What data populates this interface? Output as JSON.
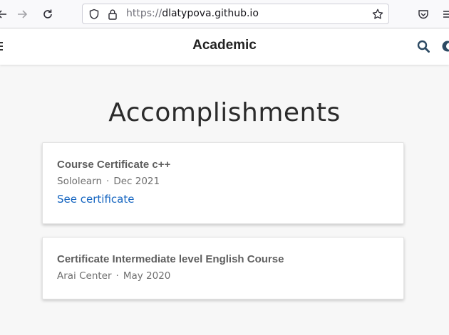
{
  "browser": {
    "url_protocol": "https://",
    "url_host": "dlatypova.github.io",
    "icons": [
      "back-arrow-icon",
      "forward-arrow-icon",
      "reload-icon",
      "shield-icon",
      "lock-icon",
      "bookmark-star-icon",
      "pocket-icon",
      "menu-icon"
    ]
  },
  "site": {
    "brand": "Academic",
    "icons": [
      "search-icon",
      "theme-toggle-icon",
      "menu-icon"
    ]
  },
  "main": {
    "title": "Accomplishments",
    "items": [
      {
        "title": "Course Certificate c++",
        "organization": "Sololearn",
        "separator": "·",
        "date": "Dec 2021",
        "link_label": "See certificate"
      },
      {
        "title": "Certificate Intermediate level English Course",
        "organization": "Arai Center",
        "separator": "·",
        "date": "May 2020"
      }
    ]
  },
  "colors": {
    "link": "#1565c0",
    "background": "#f7f7f7",
    "card": "#ffffff"
  }
}
